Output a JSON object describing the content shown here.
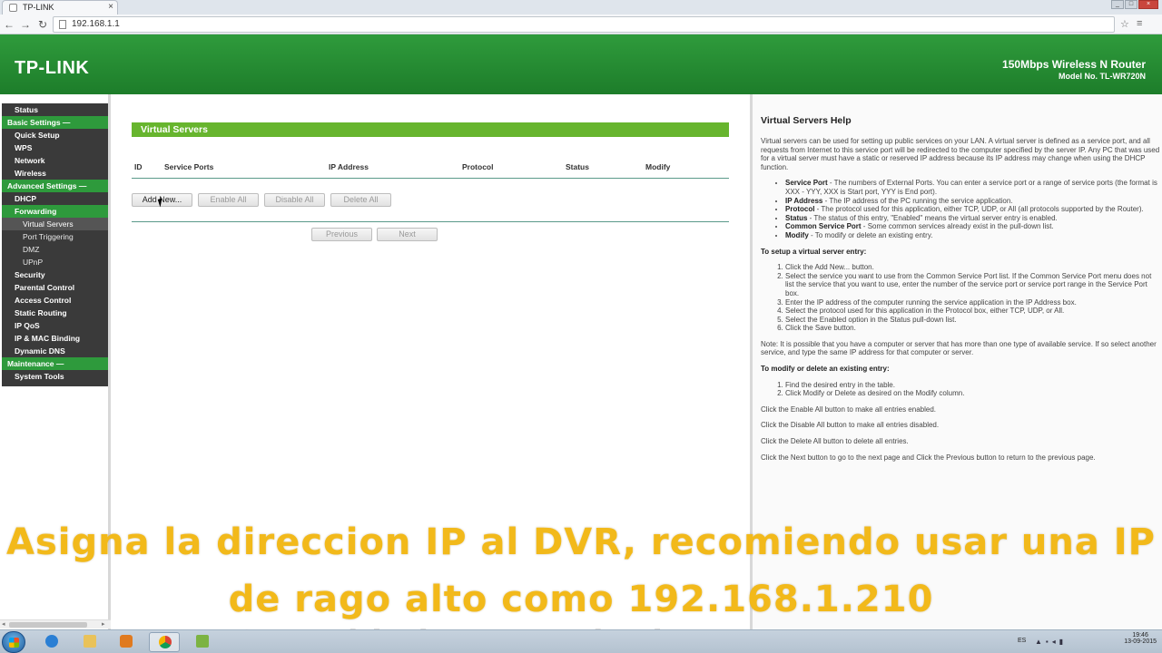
{
  "browser": {
    "tab_title": "TP-LINK",
    "tab_close": "×",
    "url": "192.168.1.1",
    "back": "←",
    "forward": "→",
    "reload": "↻"
  },
  "header": {
    "logo": "TP-LINK",
    "product": "150Mbps Wireless N Router",
    "model": "Model No. TL-WR720N"
  },
  "nav": {
    "items": [
      {
        "label": "Status",
        "kind": "item"
      },
      {
        "label": "Basic Settings —",
        "kind": "group"
      },
      {
        "label": "Quick Setup",
        "kind": "item"
      },
      {
        "label": "WPS",
        "kind": "item"
      },
      {
        "label": "Network",
        "kind": "item"
      },
      {
        "label": "Wireless",
        "kind": "item"
      },
      {
        "label": "Advanced Settings —",
        "kind": "group"
      },
      {
        "label": "DHCP",
        "kind": "item"
      },
      {
        "label": "Forwarding",
        "kind": "active"
      },
      {
        "label": "Virtual Servers",
        "kind": "sub-selected"
      },
      {
        "label": "Port Triggering",
        "kind": "sub"
      },
      {
        "label": "DMZ",
        "kind": "sub"
      },
      {
        "label": "UPnP",
        "kind": "sub"
      },
      {
        "label": "Security",
        "kind": "item"
      },
      {
        "label": "Parental Control",
        "kind": "item"
      },
      {
        "label": "Access Control",
        "kind": "item"
      },
      {
        "label": "Static Routing",
        "kind": "item"
      },
      {
        "label": "IP QoS",
        "kind": "item"
      },
      {
        "label": "IP & MAC Binding",
        "kind": "item"
      },
      {
        "label": "Dynamic DNS",
        "kind": "item"
      },
      {
        "label": "Maintenance —",
        "kind": "group"
      },
      {
        "label": "System Tools",
        "kind": "item"
      }
    ]
  },
  "main": {
    "section_title": "Virtual Servers",
    "columns": {
      "id": "ID",
      "service_ports": "Service Ports",
      "ip_address": "IP Address",
      "protocol": "Protocol",
      "status": "Status",
      "modify": "Modify"
    },
    "buttons": {
      "add_new": "Add New...",
      "enable_all": "Enable All",
      "disable_all": "Disable All",
      "delete_all": "Delete All",
      "previous": "Previous",
      "next": "Next"
    }
  },
  "help": {
    "title": "Virtual Servers Help",
    "intro": "Virtual servers can be used for setting up public services on your LAN. A virtual server is defined as a service port, and all requests from Internet to this service port will be redirected to the computer specified by the server IP. Any PC that was used for a virtual server must have a static or reserved IP address because its IP address may change when using the DHCP function.",
    "definitions": [
      {
        "term": "Service Port",
        "text": " - The numbers of External Ports. You can enter a service port or a range of service ports (the format is XXX - YYY, XXX is Start port, YYY is End port)."
      },
      {
        "term": "IP Address",
        "text": " - The IP address of the PC running the service application."
      },
      {
        "term": "Protocol",
        "text": " - The protocol used for this application, either TCP, UDP, or All (all protocols supported by the Router)."
      },
      {
        "term": "Status",
        "text": " - The status of this entry, \"Enabled\" means the virtual server entry is enabled."
      },
      {
        "term": "Common Service Port",
        "text": " - Some common services already exist in the pull-down list."
      },
      {
        "term": "Modify",
        "text": " - To modify or delete an existing entry."
      }
    ],
    "setup_heading": "To setup a virtual server entry:",
    "setup_steps": [
      "Click the Add New... button.",
      "Select the service you want to use from the Common Service Port list. If the Common Service Port menu does not list the service that you want to use, enter the number of the service port or service port range in the Service Port box.",
      "Enter the IP address of the computer running the service application in the IP Address box.",
      "Select the protocol used for this application in the Protocol box, either TCP, UDP, or All.",
      "Select the Enabled option in the Status pull-down list.",
      "Click the Save button."
    ],
    "note": "Note: It is possible that you have a computer or server that has more than one type of available service. If so select another service, and type the same IP address for that computer or server.",
    "modify_heading": "To modify or delete an existing entry:",
    "modify_steps": [
      "Find the desired entry in the table.",
      "Click Modify or Delete as desired on the Modify column."
    ],
    "tips": [
      "Click the Enable All button to make all entries enabled.",
      "Click the Disable All button to make all entries disabled.",
      "Click the Delete All button to delete all entries.",
      "Click the Next button to go to the next page and Click the Previous button to return to the previous page."
    ]
  },
  "overlay": {
    "line1": "Asigna la direccion IP al DVR, recomiendo usar una IP",
    "line2": "de rago alto como 192.168.1.210",
    "watermark": "Seguridad & Tecnologia"
  },
  "taskbar": {
    "lang": "ES",
    "time": "19:46",
    "date": "13-09-2015"
  },
  "colors": {
    "header_green": "#1d7d2a",
    "section_green": "#67b52e",
    "nav_dark": "#3a3a3a",
    "subtitle_yellow": "#f2b91a"
  }
}
